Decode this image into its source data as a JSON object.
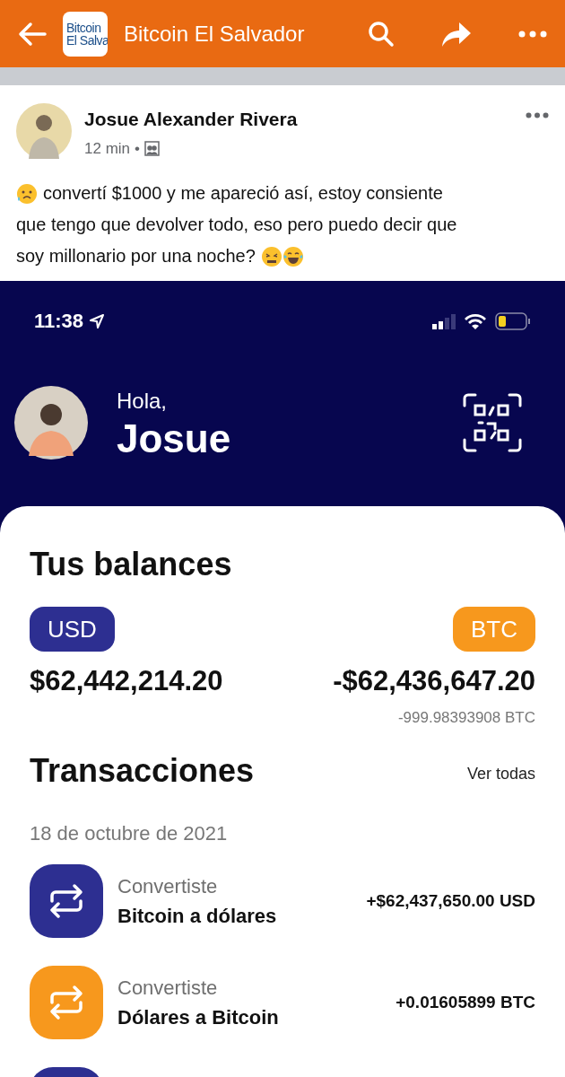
{
  "top_bar": {
    "title": "Bitcoin El Salvador",
    "logo_text": [
      "Bitcoin",
      "El Salva"
    ]
  },
  "post": {
    "author": "Josue Alexander Rivera",
    "time": "12 min",
    "separator": "•",
    "text_lines": [
      "convertí $1000 y me apareció así, estoy consiente",
      "que tengo que devolver todo, eso pero puedo decir que",
      "soy millonario por una noche?"
    ]
  },
  "wallet": {
    "status_time": "11:38",
    "greeting": "Hola,",
    "name": "Josue",
    "balances_title": "Tus balances",
    "balances": [
      {
        "kind": "usd",
        "currency": "USD",
        "amount": "$62,442,214.20"
      },
      {
        "kind": "btc",
        "currency": "BTC",
        "amount": "-$62,436,647.20",
        "sub": "-999.98393908 BTC"
      }
    ],
    "transactions_title": "Transacciones",
    "see_all": "Ver todas",
    "date": "18 de octubre de 2021",
    "transactions": [
      {
        "kind": "usd",
        "label": "Convertiste",
        "title": "Bitcoin a dólares",
        "amount": "+$62,437,650.00 USD"
      },
      {
        "kind": "btc",
        "label": "Convertiste",
        "title": "Dólares a Bitcoin",
        "amount": "+0.01605899 BTC"
      },
      {
        "kind": "usd"
      }
    ]
  }
}
